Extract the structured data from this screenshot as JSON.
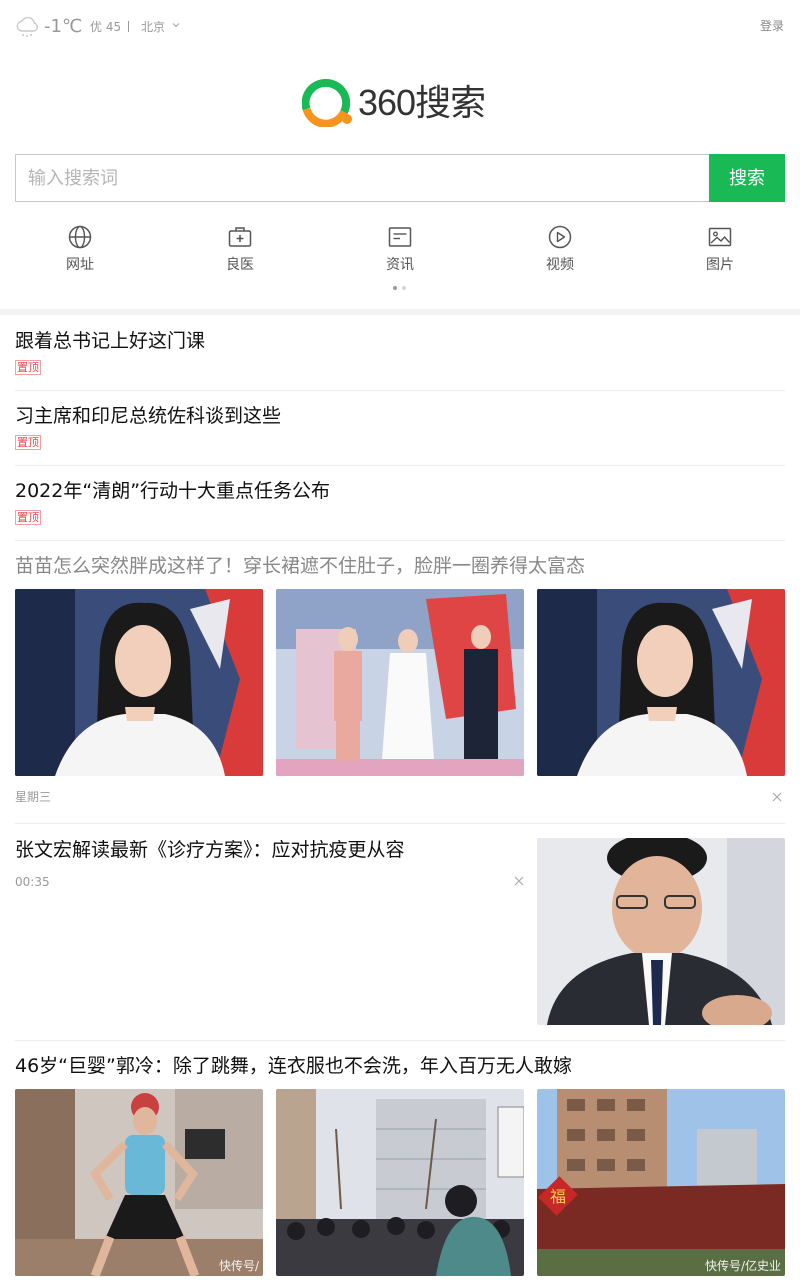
{
  "header": {
    "temperature": "-1℃",
    "aqi": "优 45",
    "city": "北京",
    "login_label": "登录",
    "weather_icon": "cloud-snow-icon"
  },
  "logo": {
    "text": "360搜索"
  },
  "search": {
    "placeholder": "输入搜索词",
    "value": "",
    "button_label": "搜索"
  },
  "nav": [
    {
      "label": "网址",
      "icon": "globe-icon"
    },
    {
      "label": "良医",
      "icon": "medkit-icon"
    },
    {
      "label": "资讯",
      "icon": "news-icon"
    },
    {
      "label": "视频",
      "icon": "play-icon"
    },
    {
      "label": "图片",
      "icon": "image-icon"
    }
  ],
  "pinned": [
    {
      "title": "跟着总书记上好这门课",
      "badge": "置顶"
    },
    {
      "title": "习主席和印尼总统佐科谈到这些",
      "badge": "置顶"
    },
    {
      "title": "2022年“清朗”行动十大重点任务公布",
      "badge": "置顶"
    }
  ],
  "feed": [
    {
      "title": "苗苗怎么突然胖成这样了！穿长裙遮不住肚子，脸胖一圈养得太富态",
      "meta": "星期三"
    },
    {
      "title": "张文宏解读最新《诊疗方案》：应对抗疫更从容",
      "meta": "00:35"
    },
    {
      "title": "46岁“巨婴”郭冷：除了跳舞，连衣服也不会洗，年入百万无人敢嫁",
      "watermarks": [
        "快传号/",
        "快传号/亿史业"
      ]
    }
  ],
  "colors": {
    "brand_green": "#19b955",
    "logo_orange": "#f7941d",
    "pin_red": "#e44444"
  }
}
